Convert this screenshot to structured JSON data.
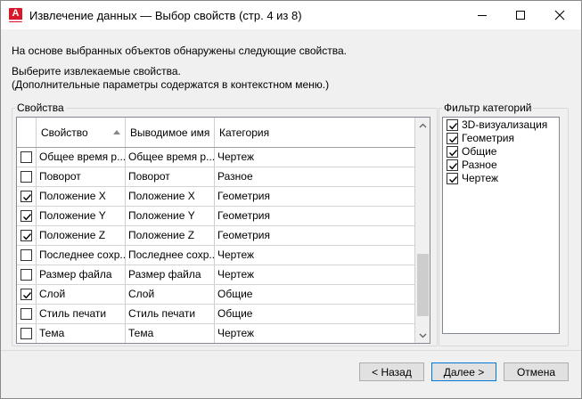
{
  "window": {
    "title": "Извлечение данных — Выбор свойств (стр. 4 из 8)",
    "app_logo_letter": "A",
    "controls": [
      "minimize-icon",
      "maximize-icon",
      "close-icon"
    ]
  },
  "messages": {
    "line1": "На основе выбранных объектов обнаружены следующие свойства.",
    "line2": "Выберите извлекаемые свойства.",
    "line3": "(Дополнительные параметры содержатся в контекстном меню.)"
  },
  "properties_group": {
    "legend": "Свойства",
    "columns": {
      "property": "Свойство",
      "display_name": "Выводимое имя",
      "category": "Категория"
    },
    "sort": "ascending",
    "rows": [
      {
        "checked": false,
        "property": "Общее время р...",
        "display_name": "Общее время р...",
        "category": "Чертеж"
      },
      {
        "checked": false,
        "property": "Поворот",
        "display_name": "Поворот",
        "category": "Разное"
      },
      {
        "checked": true,
        "property": "Положение X",
        "display_name": "Положение X",
        "category": "Геометрия"
      },
      {
        "checked": true,
        "property": "Положение Y",
        "display_name": "Положение Y",
        "category": "Геометрия"
      },
      {
        "checked": true,
        "property": "Положение Z",
        "display_name": "Положение Z",
        "category": "Геометрия"
      },
      {
        "checked": false,
        "property": "Последнее сохр...",
        "display_name": "Последнее сохр...",
        "category": "Чертеж"
      },
      {
        "checked": false,
        "property": "Размер файла",
        "display_name": "Размер файла",
        "category": "Чертеж"
      },
      {
        "checked": true,
        "property": "Слой",
        "display_name": "Слой",
        "category": "Общие"
      },
      {
        "checked": false,
        "property": "Стиль печати",
        "display_name": "Стиль печати",
        "category": "Общие"
      },
      {
        "checked": false,
        "property": "Тема",
        "display_name": "Тема",
        "category": "Чертеж"
      }
    ]
  },
  "category_filter": {
    "legend": "Фильтр категорий",
    "items": [
      {
        "checked": true,
        "label": "3D-визуализация"
      },
      {
        "checked": true,
        "label": "Геометрия"
      },
      {
        "checked": true,
        "label": "Общие"
      },
      {
        "checked": true,
        "label": "Разное"
      },
      {
        "checked": true,
        "label": "Чертеж"
      }
    ]
  },
  "buttons": {
    "back": "< Назад",
    "next": "Далее >",
    "cancel": "Отмена"
  },
  "colors": {
    "brand": "#d7182a",
    "focus": "#0078d7",
    "dialog_bg": "#f0f0f0"
  }
}
